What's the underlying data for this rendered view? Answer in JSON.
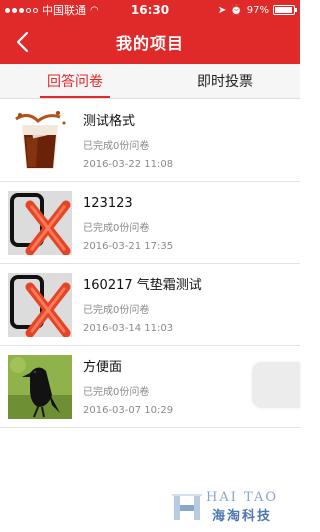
{
  "status_bar": {
    "carrier": "中国联通",
    "time": "16:30",
    "battery_level": "97%"
  },
  "nav": {
    "title": "我的项目"
  },
  "tabs": [
    {
      "label": "回答问卷",
      "active": true
    },
    {
      "label": "即时投票",
      "active": false
    }
  ],
  "items": [
    {
      "title": "测试格式",
      "status": "已完成0份问卷",
      "date": "2016-03-22 11:08",
      "thumb": "drink-photo"
    },
    {
      "title": "123123",
      "status": "已完成0份问卷",
      "date": "2016-03-21 17:35",
      "thumb": "broken-image-icon"
    },
    {
      "title": "160217 气垫霜测试",
      "status": "已完成0份问卷",
      "date": "2016-03-14 11:03",
      "thumb": "broken-image-icon"
    },
    {
      "title": "方便面",
      "status": "已完成0份问卷",
      "date": "2016-03-07 10:29",
      "thumb": "bird-photo"
    }
  ],
  "watermark": {
    "en": "HAI TAO",
    "cn": "海淘科技"
  },
  "colors": {
    "accent": "#e02a2a",
    "text_secondary": "#8a8a8a"
  }
}
